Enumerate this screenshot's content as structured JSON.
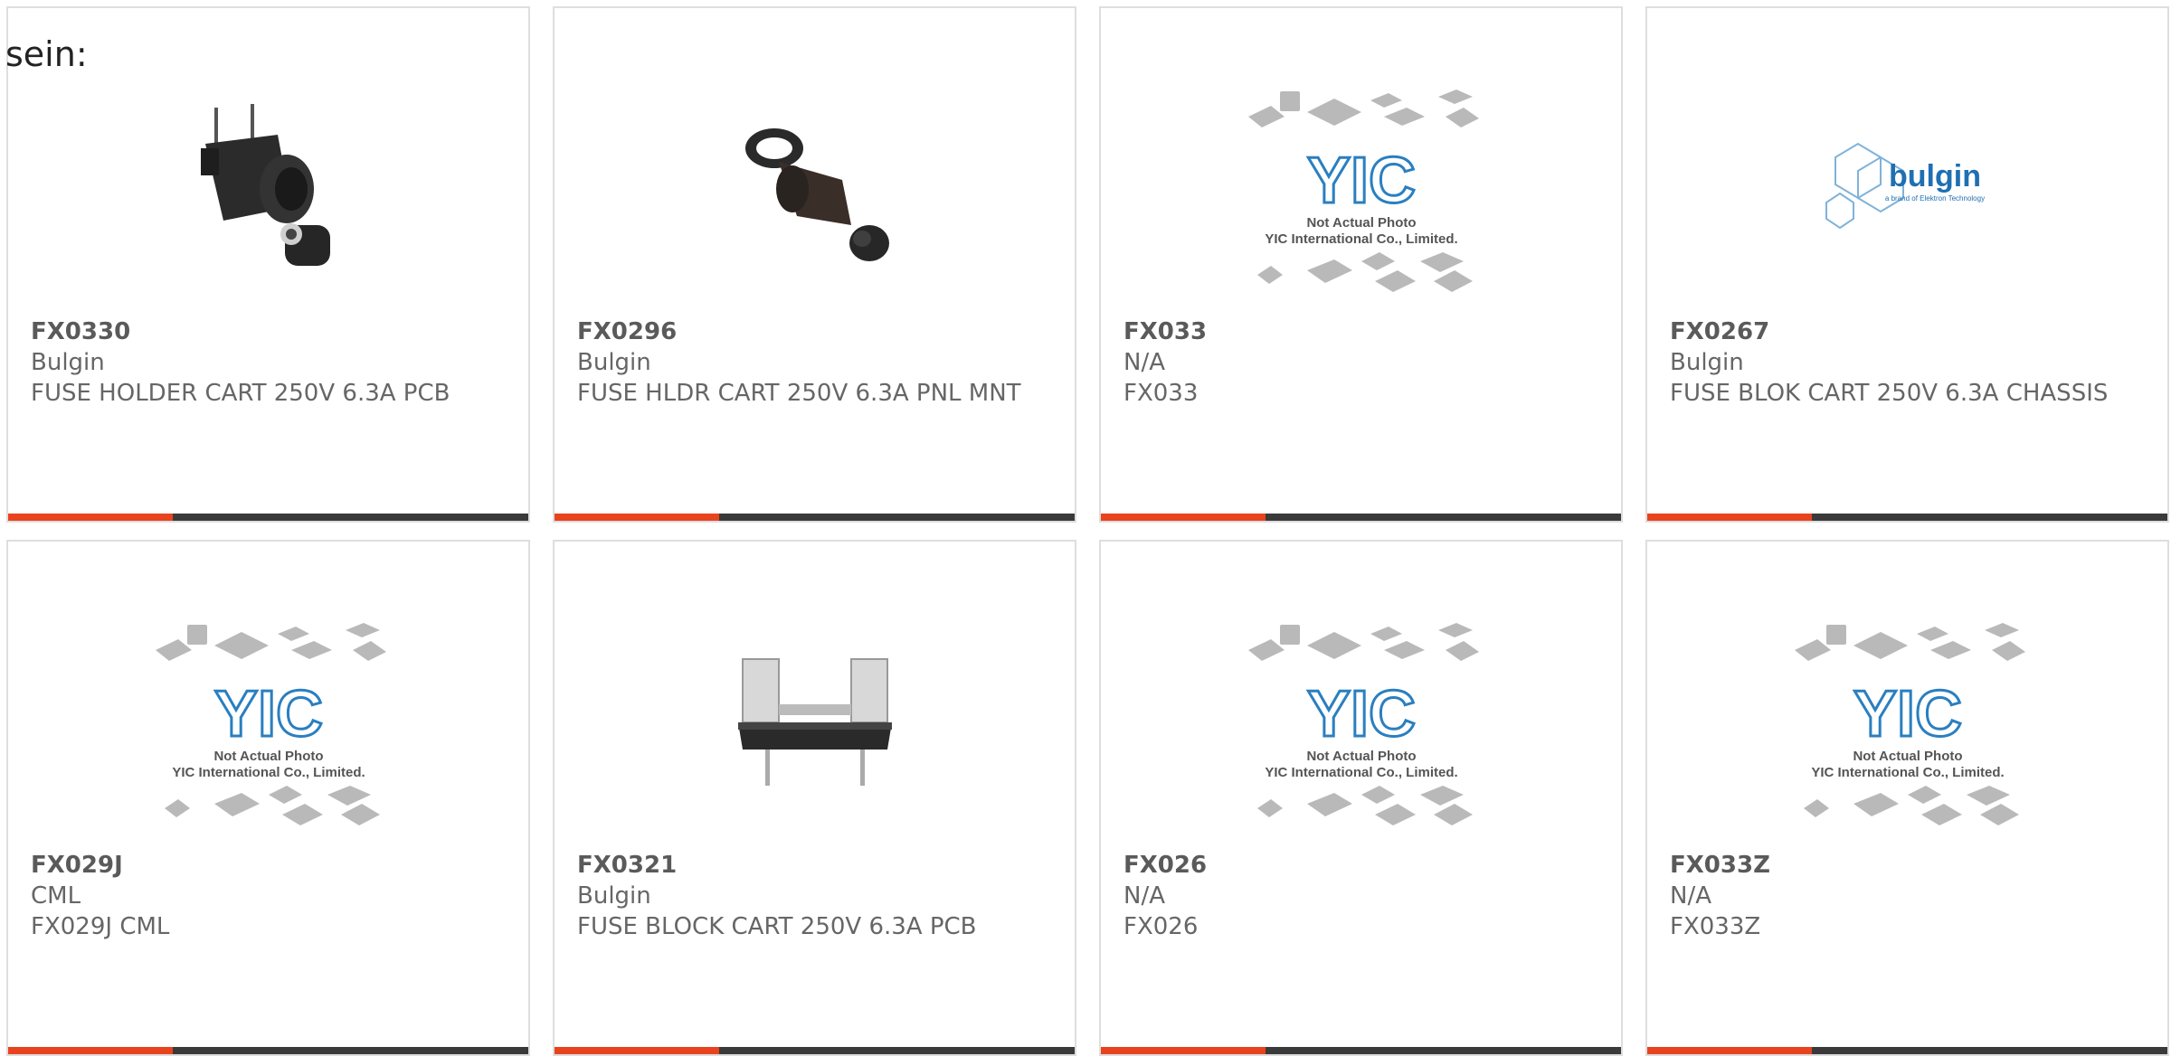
{
  "page": {
    "label": "sein:",
    "accent_color": "#e8431e",
    "bar_color": "#3a3a3a"
  },
  "placeholder_image": {
    "line1": "Not Actual Photo",
    "line2": "YIC International Co., Limited."
  },
  "bulgin_logo": {
    "brand": "bulgin",
    "tagline": "a brand of Elektron Technology"
  },
  "products": [
    {
      "part": "FX0330",
      "manufacturer": "Bulgin",
      "description": "FUSE HOLDER CART 250V 6.3A PCB",
      "image": "fuse-holder-photo-icon"
    },
    {
      "part": "FX0296",
      "manufacturer": "Bulgin",
      "description": "FUSE HLDR CART 250V 6.3A PNL MNT",
      "image": "panel-fuse-holder-photo-icon"
    },
    {
      "part": "FX033",
      "manufacturer": "N/A",
      "description": "FX033",
      "image": "yic-placeholder-icon"
    },
    {
      "part": "FX0267",
      "manufacturer": "Bulgin",
      "description": "FUSE BLOK CART 250V 6.3A CHASSIS",
      "image": "bulgin-logo-icon"
    },
    {
      "part": "FX029J",
      "manufacturer": "CML",
      "description": "FX029J CML",
      "image": "yic-placeholder-icon"
    },
    {
      "part": "FX0321",
      "manufacturer": "Bulgin",
      "description": "FUSE BLOCK CART 250V 6.3A PCB",
      "image": "fuse-block-photo-icon"
    },
    {
      "part": "FX026",
      "manufacturer": "N/A",
      "description": "FX026",
      "image": "yic-placeholder-icon"
    },
    {
      "part": "FX033Z",
      "manufacturer": "N/A",
      "description": "FX033Z",
      "image": "yic-placeholder-icon"
    }
  ]
}
